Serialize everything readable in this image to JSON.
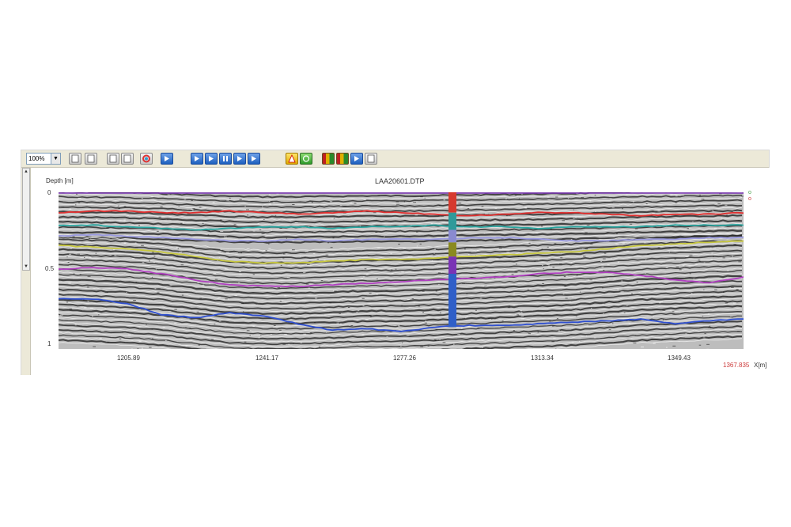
{
  "toolbar": {
    "zoom_value": "100%",
    "buttons": [
      {
        "icon": "page-icon",
        "style": "gray"
      },
      {
        "icon": "page-icon",
        "style": "gray"
      },
      {
        "icon": "print-icon",
        "style": "gray"
      },
      {
        "icon": "save-icon",
        "style": "gray"
      },
      {
        "icon": "color-wheel-icon",
        "style": "gray"
      },
      {
        "icon": "font-icon",
        "style": "blue"
      },
      {
        "icon": "first-icon",
        "style": "blue"
      },
      {
        "icon": "rewind-icon",
        "style": "blue"
      },
      {
        "icon": "pause-icon",
        "style": "blue"
      },
      {
        "icon": "forward-icon",
        "style": "blue"
      },
      {
        "icon": "last-icon",
        "style": "blue"
      },
      {
        "icon": "warning-icon",
        "style": "yellow"
      },
      {
        "icon": "refresh-icon",
        "style": "green"
      },
      {
        "icon": "layer-icon",
        "style": "multi"
      },
      {
        "icon": "layer-edit-icon",
        "style": "multi"
      },
      {
        "icon": "marker-icon",
        "style": "blue"
      },
      {
        "icon": "settings-icon",
        "style": "gray"
      }
    ]
  },
  "plot": {
    "title": "LAA20601.DTP",
    "ylabel": "Depth [m]",
    "y_ticks": [
      "0",
      "0.5",
      "1"
    ],
    "x_ticks": [
      "1205.89",
      "1241.17",
      "1277.26",
      "1313.34",
      "1349.43"
    ],
    "x_end_value": "1367.835",
    "x_unit": "X[m]",
    "legend_marks": [
      "o",
      "o"
    ],
    "colors": {
      "background": "#ffffff",
      "seismic_dark": "#2b2b2b",
      "marker_axis": "#7a33b5",
      "end_value": "#cc3a3a",
      "legend_green": "#4aa34a",
      "legend_red": "#cc3a3a"
    },
    "well_column_colors": [
      "#d63a2e",
      "#2f9a9a",
      "#8a8ad0",
      "#8a8a20",
      "#7a33b5",
      "#2f5fc8"
    ],
    "horizons": [
      {
        "color": "#e03030",
        "depths": [
          0.13,
          0.12,
          0.12,
          0.13,
          0.13,
          0.12,
          0.13,
          0.14,
          0.13,
          0.12,
          0.13,
          0.14,
          0.15,
          0.14,
          0.13,
          0.13,
          0.14,
          0.15,
          0.14,
          0.14,
          0.13
        ]
      },
      {
        "color": "#2aa6a0",
        "depths": [
          0.21,
          0.21,
          0.22,
          0.23,
          0.24,
          0.23,
          0.22,
          0.22,
          0.23,
          0.22,
          0.22,
          0.21,
          0.22,
          0.22,
          0.23,
          0.22,
          0.22,
          0.22,
          0.21,
          0.21,
          0.21
        ]
      },
      {
        "color": "#9a9ae0",
        "depths": [
          0.28,
          0.27,
          0.28,
          0.29,
          0.3,
          0.31,
          0.31,
          0.3,
          0.31,
          0.3,
          0.3,
          0.3,
          0.29,
          0.29,
          0.3,
          0.31,
          0.31,
          0.3,
          0.3,
          0.29,
          0.29
        ]
      },
      {
        "color": "#c8c840",
        "depths": [
          0.34,
          0.35,
          0.36,
          0.38,
          0.41,
          0.44,
          0.45,
          0.45,
          0.44,
          0.43,
          0.43,
          0.42,
          0.41,
          0.4,
          0.39,
          0.38,
          0.36,
          0.34,
          0.33,
          0.32,
          0.31
        ]
      },
      {
        "color": "#b040c0",
        "depths": [
          0.49,
          0.48,
          0.49,
          0.52,
          0.56,
          0.59,
          0.6,
          0.6,
          0.59,
          0.58,
          0.57,
          0.56,
          0.55,
          0.54,
          0.52,
          0.51,
          0.51,
          0.53,
          0.56,
          0.58,
          0.54
        ]
      },
      {
        "color": "#3050d0",
        "depths": [
          0.68,
          0.68,
          0.71,
          0.78,
          0.8,
          0.77,
          0.79,
          0.84,
          0.88,
          0.87,
          0.89,
          0.86,
          0.85,
          0.85,
          0.84,
          0.83,
          0.82,
          0.81,
          0.84,
          0.82,
          0.81
        ]
      }
    ]
  }
}
